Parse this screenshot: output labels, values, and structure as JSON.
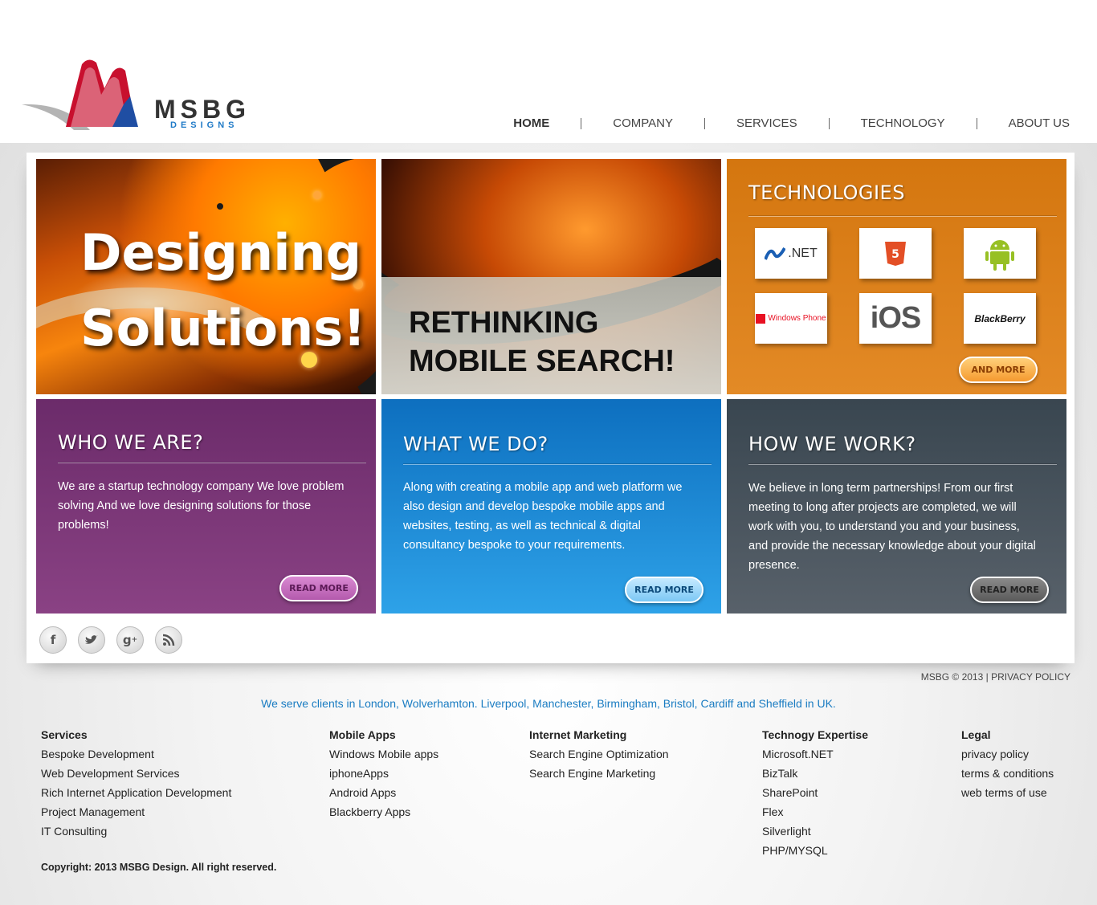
{
  "brand": {
    "name": "MSBG",
    "sub": "DESIGNS",
    "colors": {
      "red": "#c8102e",
      "blue": "#1f4ea3"
    }
  },
  "nav": [
    "HOME",
    "COMPANY",
    "SERVICES",
    "TECHNOLOGY",
    "ABOUT US"
  ],
  "banner1": {
    "line1": "Designing",
    "line2": "Solutions!"
  },
  "banner2": {
    "line1": "RETHINKING",
    "line2": "MOBILE SEARCH!"
  },
  "tech": {
    "title": "TECHNOLOGIES",
    "items": [
      ".NET",
      "HTML 5",
      "Android",
      "Windows Phone",
      "iOS",
      "BlackBerry"
    ],
    "button": "AND MORE"
  },
  "who": {
    "title": "WHO WE ARE?",
    "body": "We are a startup technology company We love problem solving And we love designing solutions for those problems!",
    "button": "READ MORE"
  },
  "what": {
    "title": "WHAT WE DO?",
    "body": "Along with creating a mobile app and web platform we also design and develop bespoke mobile apps and  websites, testing, as well as technical & digital consultancy bespoke to your requirements.",
    "button": "READ MORE"
  },
  "how": {
    "title": "HOW WE WORK?",
    "body": "We believe in long term partnerships! From our first meeting to long after projects are completed, we will work with you, to understand you and your business, and provide the necessary knowledge about your digital presence.",
    "button": "READ MORE"
  },
  "social": [
    "facebook-icon",
    "twitter-icon",
    "google-plus-icon",
    "rss-icon"
  ],
  "footer": {
    "top_right": "MSBG © 2013 | PRIVACY POLICY",
    "serve": "We serve clients in London, Wolverhamton. Liverpool, Manchester, Birmingham, Bristol, Cardiff and Sheffield in UK.",
    "columns": [
      {
        "heading": "Services",
        "links": [
          "Bespoke Development",
          "Web Development Services",
          "Rich Internet Application Development",
          "Project Management",
          "IT Consulting"
        ]
      },
      {
        "heading": "Mobile Apps",
        "links": [
          "Windows Mobile apps",
          "iphoneApps",
          "Android Apps",
          "Blackberry Apps"
        ]
      },
      {
        "heading": "Internet Marketing",
        "links": [
          "Search Engine Optimization",
          "Search Engine Marketing"
        ]
      },
      {
        "heading": "Technogy Expertise",
        "links": [
          "Microsoft.NET",
          "BizTalk",
          "SharePoint",
          "Flex",
          "Silverlight",
          "PHP/MYSQL"
        ]
      },
      {
        "heading": "Legal",
        "links": [
          "privacy policy",
          "terms & conditions",
          "web terms of use"
        ]
      }
    ],
    "copyright": "Copyright: 2013 MSBG Design. All right reserved."
  }
}
